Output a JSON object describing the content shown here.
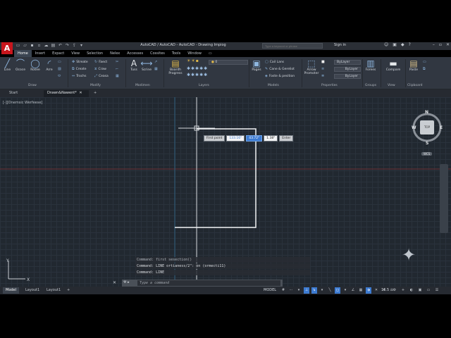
{
  "app": {
    "logo": "A",
    "title": "AutoCAD / AutoCAD - AutoCAD - Drawing Impiog",
    "search_placeholder": "Type a keyword or phrase",
    "signin": "Sign in"
  },
  "ribbon_tabs": [
    "Home",
    "Insert",
    "Expact",
    "View",
    "Selection",
    "Nelex",
    "Accesses",
    "Cossites",
    "Tools",
    "Window"
  ],
  "ribbon": {
    "draw": [
      "Line",
      "Ococe",
      "Rosee",
      "Arre"
    ],
    "modify_small": [
      "Streate",
      "Create",
      "Trochs"
    ],
    "modify_small2": [
      "Faect",
      "Craw",
      "Ceasa"
    ],
    "mod_tools": [
      "Tuss",
      "Scrine"
    ],
    "modify_big": "Boardh Progress",
    "layer_value": "0",
    "model_tools": [
      "Cail Lans",
      "Cane & Gereliot",
      "Foste & pesition"
    ],
    "arrow": "Arrow Promoter",
    "panel_tools": [
      "Pages",
      "Forees"
    ],
    "by_layer": [
      "ByLayer",
      "ByLayer",
      "ByLayer"
    ],
    "groups": "Groups",
    "utilities": "Compare",
    "clipboard": "Paste",
    "panels": [
      "Draw",
      "Modify",
      "Modimen",
      "Layers",
      "Models",
      "Properties",
      "Groups",
      "View",
      "Clipboard"
    ]
  },
  "file_tabs": [
    "Start",
    "Drawn&Nawent*"
  ],
  "viewport_label": "[-][Onemsic Werfeese]",
  "dynamic_input": {
    "prompt": "First point",
    "x_value": "133.16\"",
    "y_value": "43.72\"",
    "z_value": "1.38\"",
    "enter": "Enter"
  },
  "viewcube": {
    "face": "TOP",
    "n": "N",
    "w": "W",
    "e": "E",
    "s": "S",
    "wcs": "WCS"
  },
  "command_history": [
    "Command: first sesection()",
    "Command: LINE ortianess/2\": on (ormecti11)",
    "Command: LINE"
  ],
  "command_input_placeholder": "Type a command",
  "status_tabs": [
    "Model",
    "Layout1",
    "Layout1"
  ],
  "status": {
    "model": "MODEL",
    "scale": "1:1",
    "scale_text": "16.5"
  },
  "colors": {
    "accent": "#3d7bd1",
    "logo": "#c8161d",
    "canvas": "#212830"
  },
  "icons": {
    "close": "close-icon",
    "wrench": "wrench-icon",
    "navwheel": "navigation-star-icon",
    "gear": "gear-icon",
    "plus": "plus-icon"
  }
}
